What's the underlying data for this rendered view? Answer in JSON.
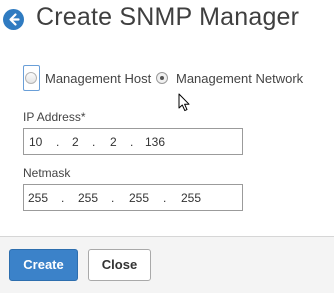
{
  "header": {
    "back_icon": "back-arrow-icon",
    "title": "Create SNMP Manager"
  },
  "manager_type": {
    "selected": "Management Network",
    "options": [
      {
        "label": "Management Host"
      },
      {
        "label": "Management Network"
      }
    ]
  },
  "ip_address": {
    "label": "IP Address*",
    "octets": [
      "10",
      "2",
      "2",
      "136"
    ]
  },
  "netmask": {
    "label": "Netmask",
    "octets": [
      "255",
      "255",
      "255",
      "255"
    ]
  },
  "footer": {
    "create_label": "Create",
    "close_label": "Close"
  },
  "colors": {
    "accent": "#3b82c9",
    "title_text": "#3f3f3f",
    "footer_background": "#f4f4f4"
  }
}
